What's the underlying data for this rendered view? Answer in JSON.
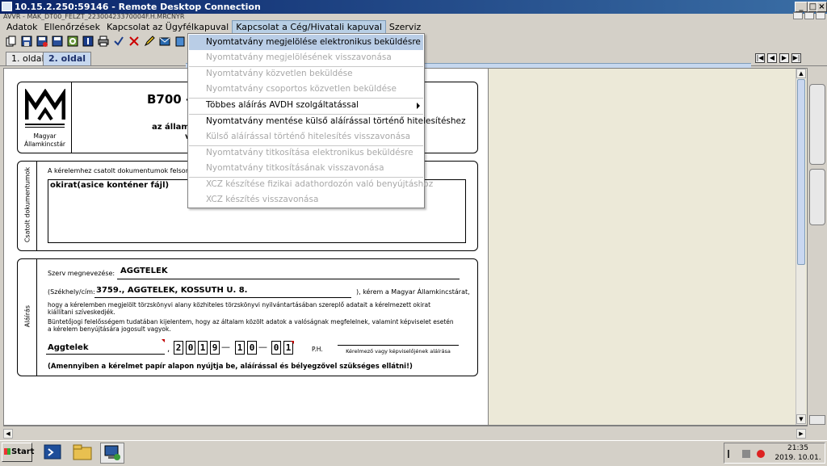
{
  "window": {
    "title": "10.15.2.250:59146 - Remote Desktop Connection",
    "inner_title": "AVVR - MAK_DT00_FELZT_22300423370004F.H.MRCNYR"
  },
  "menubar": {
    "items": [
      "Adatok",
      "Ellenőrzések",
      "Kapcsolat az Ügyfélkapuval",
      "Kapcsolat a Cég/Hivatali kapuval",
      "Szerviz"
    ]
  },
  "tabs": [
    "1. oldal",
    "2. oldal"
  ],
  "dropdown": {
    "items": [
      {
        "label": "Nyomtatvány megjelölése elektronikus beküldésre",
        "state": "highlighted"
      },
      {
        "label": "Nyomtatvány megjelölésének visszavonása",
        "state": "disabled"
      },
      {
        "label": "Nyomtatvány közvetlen beküldése",
        "state": "disabled"
      },
      {
        "label": "Nyomtatvány csoportos közvetlen beküldése",
        "state": "disabled"
      },
      {
        "label": "Többes aláírás AVDH szolgáltatással",
        "state": "enabled",
        "submenu": true
      },
      {
        "label": "Nyomtatvány mentése külső aláírással történő hitelesítéshez",
        "state": "enabled"
      },
      {
        "label": "Külső aláírással történő hitelesítés visszavonása",
        "state": "disabled"
      },
      {
        "label": "Nyomtatvány titkosítása elektronikus beküldésre",
        "state": "disabled"
      },
      {
        "label": "Nyomtatvány titkosításának visszavonása",
        "state": "disabled"
      },
      {
        "label": "XCZ készítése fizikai adathordozón való benyújtáshoz",
        "state": "disabled"
      },
      {
        "label": "XCZ készítés visszavonása",
        "state": "disabled"
      }
    ]
  },
  "form": {
    "logo_text_1": "Magyar",
    "logo_text_2": "Államkincstár",
    "form_code": "B700 -",
    "header_sub_1": "az államh",
    "header_sub_2": "v",
    "attachments_side_label": "Csatolt dokumentumok",
    "attachments_intro": "A kérelemhez csatolt dokumentumok felsorolá",
    "attachments_value": "okirat(asice konténer fájl)",
    "signature_side_label": "Aláírás",
    "org_name_label": "Szerv megnevezése:",
    "org_name_value": "AGGTELEK",
    "seat_label": "(Székhely/cím:",
    "seat_value": "3759., AGGTELEK, KOSSUTH U. 8.",
    "seat_suffix": "), kérem a Magyar Államkincstárat,",
    "request_text_1": "hogy a kérelemben megjelölt törzskönyvi alany közhiteles törzskönyvi nyilvántartásában szereplő adatait a kérelmezett okirat",
    "request_text_2": "kiállítani szíveskedjék.",
    "liability_text_1": "Büntetőjogi felelősségem tudatában kijelentem, hogy az általam közölt adatok a valóságnak megfelelnek, valamint képviselet esetén",
    "liability_text_2": "a kérelem benyújtására jogosult vagyok.",
    "place_value": "Aggtelek",
    "comma": ",",
    "year_digits": [
      "2",
      "0",
      "1",
      "9"
    ],
    "month_digits": [
      "1",
      "0"
    ],
    "day_digits": [
      "0",
      "1"
    ],
    "dash": "—",
    "ph_label": "P.H.",
    "signer_label": "Kérelmező vagy képviselőjének aláírása",
    "note": "(Amennyiben a kérelmet papír alapon nyújtja be, aláírással és bélyegzővel szükséges ellátni!)"
  },
  "taskbar": {
    "start_label": "Start",
    "time": "21:35",
    "date": "2019. 10.01."
  }
}
